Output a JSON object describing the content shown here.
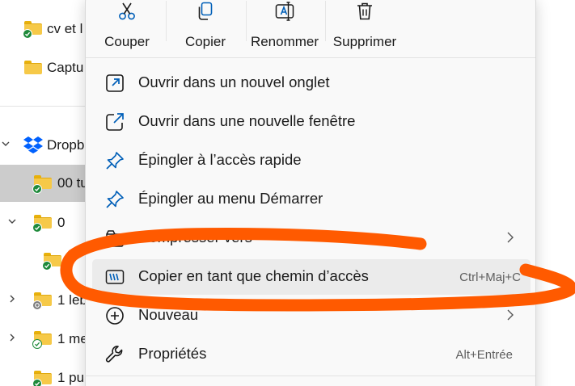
{
  "nav": {
    "items": [
      {
        "label": "cv et l",
        "icon": "folder-icon",
        "badge": "synced-check-icon"
      },
      {
        "label": "Captu",
        "icon": "folder-icon",
        "badge": ""
      },
      {
        "label": "Dropb",
        "icon": "dropbox-icon",
        "expander": "chevron-down-icon"
      },
      {
        "label": "00 tu",
        "icon": "folder-icon",
        "badge": "synced-check-icon",
        "selected": true
      },
      {
        "label": "0",
        "icon": "folder-icon",
        "badge": "synced-check-icon",
        "expander": "chevron-down-icon"
      },
      {
        "label": "",
        "icon": "folder-icon",
        "badge": "synced-check-icon"
      },
      {
        "label": "1 leb",
        "icon": "folder-icon",
        "badge": "syncing-icon",
        "expander": "chevron-right-icon"
      },
      {
        "label": "1 me",
        "icon": "folder-icon",
        "badge": "synced-outline-icon",
        "expander": "chevron-right-icon"
      },
      {
        "label": "1 pu",
        "icon": "folder-icon",
        "badge": "synced-check-icon"
      }
    ]
  },
  "quick_actions": [
    {
      "label": "Couper",
      "icon": "scissors-icon"
    },
    {
      "label": "Copier",
      "icon": "copy-icon"
    },
    {
      "label": "Renommer",
      "icon": "rename-icon"
    },
    {
      "label": "Supprimer",
      "icon": "trash-icon"
    }
  ],
  "menu": {
    "items": [
      {
        "label": "Ouvrir dans un nouvel onglet",
        "icon": "new-tab-icon",
        "accel": ""
      },
      {
        "label": "Ouvrir dans une nouvelle fenêtre",
        "icon": "new-window-icon",
        "accel": ""
      },
      {
        "label": "Épingler à l’accès rapide",
        "icon": "pin-icon",
        "accel": ""
      },
      {
        "label": "Épingler au menu Démarrer",
        "icon": "pin-icon",
        "accel": ""
      },
      {
        "label": "Compresser vers",
        "icon": "zip-icon",
        "accel": "",
        "submenu": true
      },
      {
        "label": "Copier en tant que chemin d’accès",
        "icon": "copy-path-icon",
        "accel": "Ctrl+Maj+C",
        "hover": true
      },
      {
        "label": "Nouveau",
        "icon": "plus-circle-icon",
        "accel": "",
        "submenu": true
      },
      {
        "label": "Propriétés",
        "icon": "wrench-icon",
        "accel": "Alt+Entrée"
      }
    ]
  },
  "colors": {
    "accent": "#005fb8",
    "annotation": "#ff5a00",
    "menu_bg": "#f9f9f9",
    "hover_bg": "#ebebeb",
    "folder": "#f6c948",
    "sync_ok": "#1f8a3b",
    "dropbox": "#0061fe"
  }
}
